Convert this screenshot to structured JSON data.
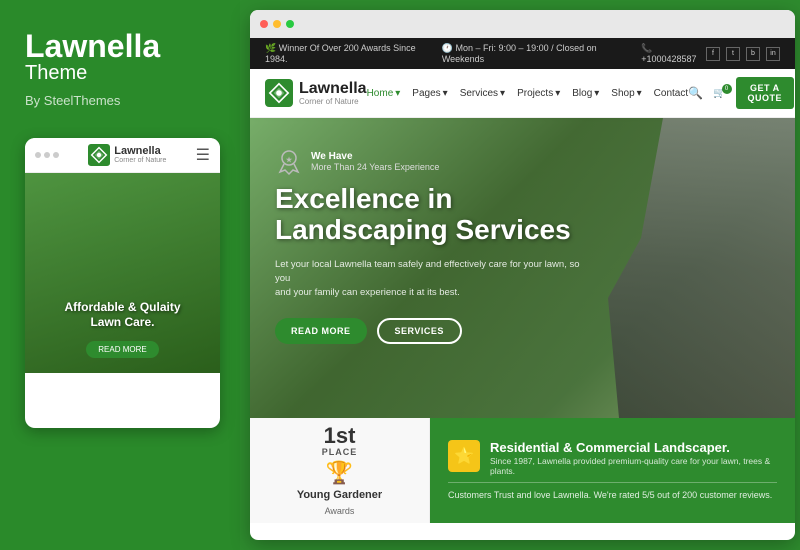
{
  "left": {
    "brand_name": "Lawnella",
    "brand_type": "Theme",
    "brand_by": "By SteelThemes",
    "mobile": {
      "dots": [
        "dot1",
        "dot2",
        "dot3"
      ],
      "logo_text": "Lawnella",
      "logo_sub": "Corner of Nature",
      "hero_text": "Affordable & Qulaity\nLawn Care.",
      "read_more": "READ MORE"
    }
  },
  "browser": {
    "dots": [
      "red",
      "yellow",
      "green"
    ]
  },
  "site": {
    "topbar": {
      "award": "🌿 Winner Of Over 200 Awards Since 1984.",
      "hours": "🕐 Mon – Fri: 9:00 – 19:00 / Closed on Weekends",
      "phone": "📞 +1000428587",
      "socials": [
        "f",
        "t",
        "b",
        "in"
      ]
    },
    "nav": {
      "logo_text": "Lawnella",
      "logo_sub": "Corner of Nature",
      "menu": [
        {
          "label": "Home",
          "active": true,
          "has_arrow": true
        },
        {
          "label": "Pages",
          "active": false,
          "has_arrow": true
        },
        {
          "label": "Services",
          "active": false,
          "has_arrow": true
        },
        {
          "label": "Projects",
          "active": false,
          "has_arrow": true
        },
        {
          "label": "Blog",
          "active": false,
          "has_arrow": true
        },
        {
          "label": "Shop",
          "active": false,
          "has_arrow": true
        },
        {
          "label": "Contact",
          "active": false,
          "has_arrow": false
        }
      ],
      "cart_count": "0",
      "get_quote": "GET A QUOTE"
    },
    "hero": {
      "award_label": "We Have",
      "award_sub": "More Than 24 Years Experience",
      "main_title": "Excellence in\nLandscaping Services",
      "description": "Let your local Lawnella team safely and effectively care for your lawn, so you\nand your family can experience it at its best.",
      "btn_read_more": "READ MORE",
      "btn_services": "SERVICES"
    },
    "award_card": {
      "place_num": "1st",
      "place_label": "PLACE",
      "name": "Young Gardener",
      "sub": "Awards"
    },
    "residential_card": {
      "title": "Residential & Commercial Landscaper.",
      "since": "Since 1987, Lawnella provided premium-quality care for your lawn, trees & plants.",
      "review": "Customers Trust and love Lawnella. We're rated 5/5 out of 200 customer reviews.",
      "star": "★"
    }
  }
}
